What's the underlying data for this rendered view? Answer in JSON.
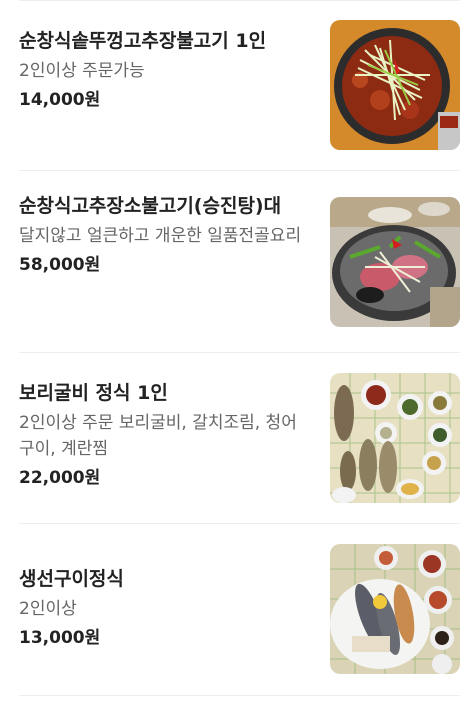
{
  "menu": {
    "items": [
      {
        "name": "순창식솥뚜껑고추장불고기 1인",
        "description": "2인이상 주문가능",
        "price": "14,000원",
        "photo_icon": "bulgogi-photo"
      },
      {
        "name": "순창식고추장소불고기(승진탕)대",
        "description": "달지않고 얼큰하고 개운한 일품전골요리",
        "price": "58,000원",
        "photo_icon": "hotpot-photo"
      },
      {
        "name": "보리굴비 정식 1인",
        "description": "2인이상 주문 보리굴비, 갈치조림, 청어구이, 계란찜",
        "price": "22,000원",
        "photo_icon": "yellow-croaker-set-photo"
      },
      {
        "name": "생선구이정식",
        "description": "2인이상",
        "price": "13,000원",
        "photo_icon": "grilled-fish-photo"
      }
    ]
  }
}
